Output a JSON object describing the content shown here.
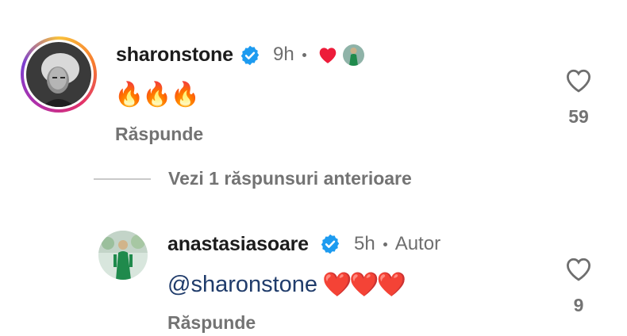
{
  "comments": [
    {
      "username": "sharonstone",
      "verified": true,
      "time": "9h",
      "text": "🔥🔥🔥",
      "reply_label": "Răspunde",
      "likes": "59",
      "liked_by_author": true
    },
    {
      "username": "anastasiasoare",
      "verified": true,
      "time": "5h",
      "author_badge": "Autor",
      "mention": "@sharonstone",
      "text": "❤️❤️❤️",
      "reply_label": "Răspunde",
      "likes": "9"
    }
  ],
  "view_replies_label": "Vezi 1 răspunsuri anterioare",
  "colors": {
    "verified": "#1d9bf0",
    "liked_heart": "#ed1c3a",
    "mention": "#203c6b",
    "secondary_text": "#737373"
  }
}
